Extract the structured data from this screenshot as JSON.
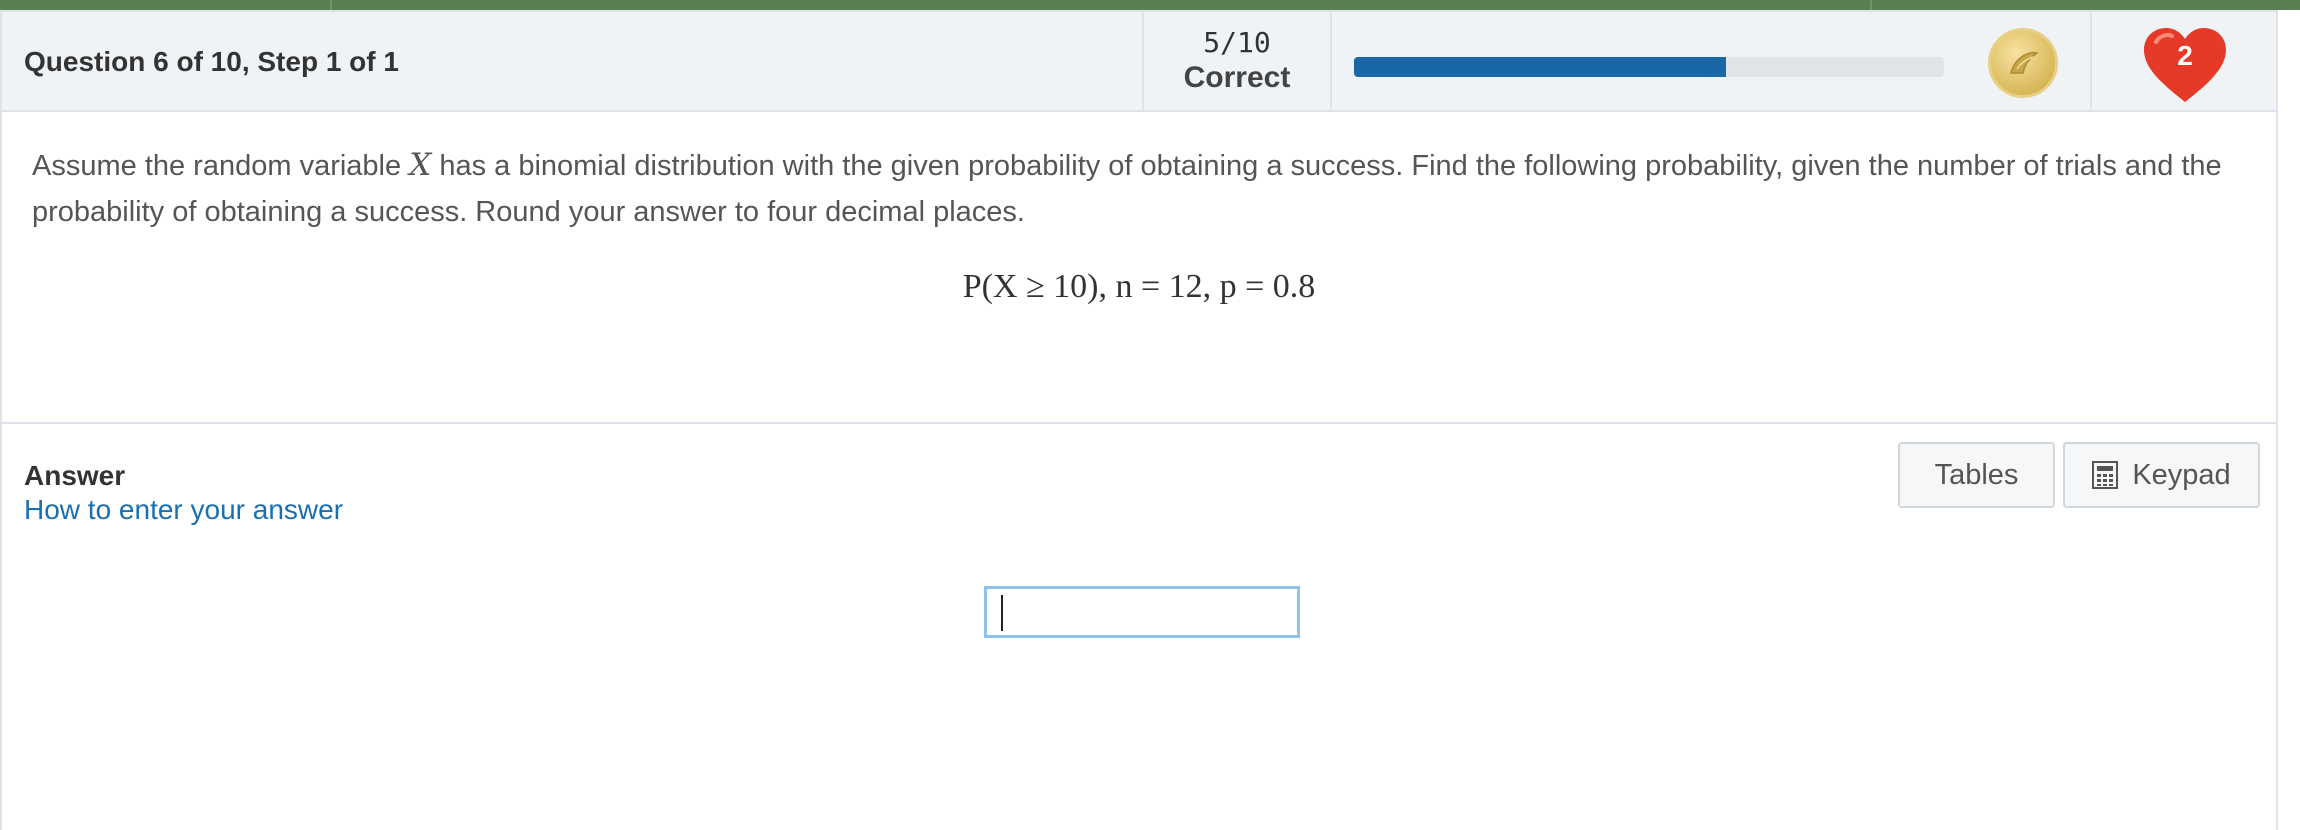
{
  "header": {
    "question_title": "Question 6 of 10, Step 1 of 1",
    "score_value": "5/10",
    "score_label": "Correct",
    "progress_fraction": 0.63,
    "progress_color": "#1a67a8",
    "coin_icon": "coin-icon",
    "hearts_count": "2",
    "heart_color": "#e63a28"
  },
  "question": {
    "text_before_var": "Assume the random variable ",
    "variable": "X",
    "text_after_var": " has a binomial distribution with the given probability of obtaining a success. Find the following probability, given the number of trials and the probability of obtaining a success. Round your answer to four decimal places.",
    "formula": "P(X ≥ 10), n = 12, p = 0.8"
  },
  "answer": {
    "label": "Answer",
    "help_link": "How to enter your answer",
    "tables_button": "Tables",
    "keypad_button": "Keypad",
    "keypad_icon": "calculator-icon",
    "input_value": ""
  },
  "colors": {
    "topbar": "#5a7f53",
    "header_bg": "#eff3f6",
    "link": "#1a6fb0"
  }
}
